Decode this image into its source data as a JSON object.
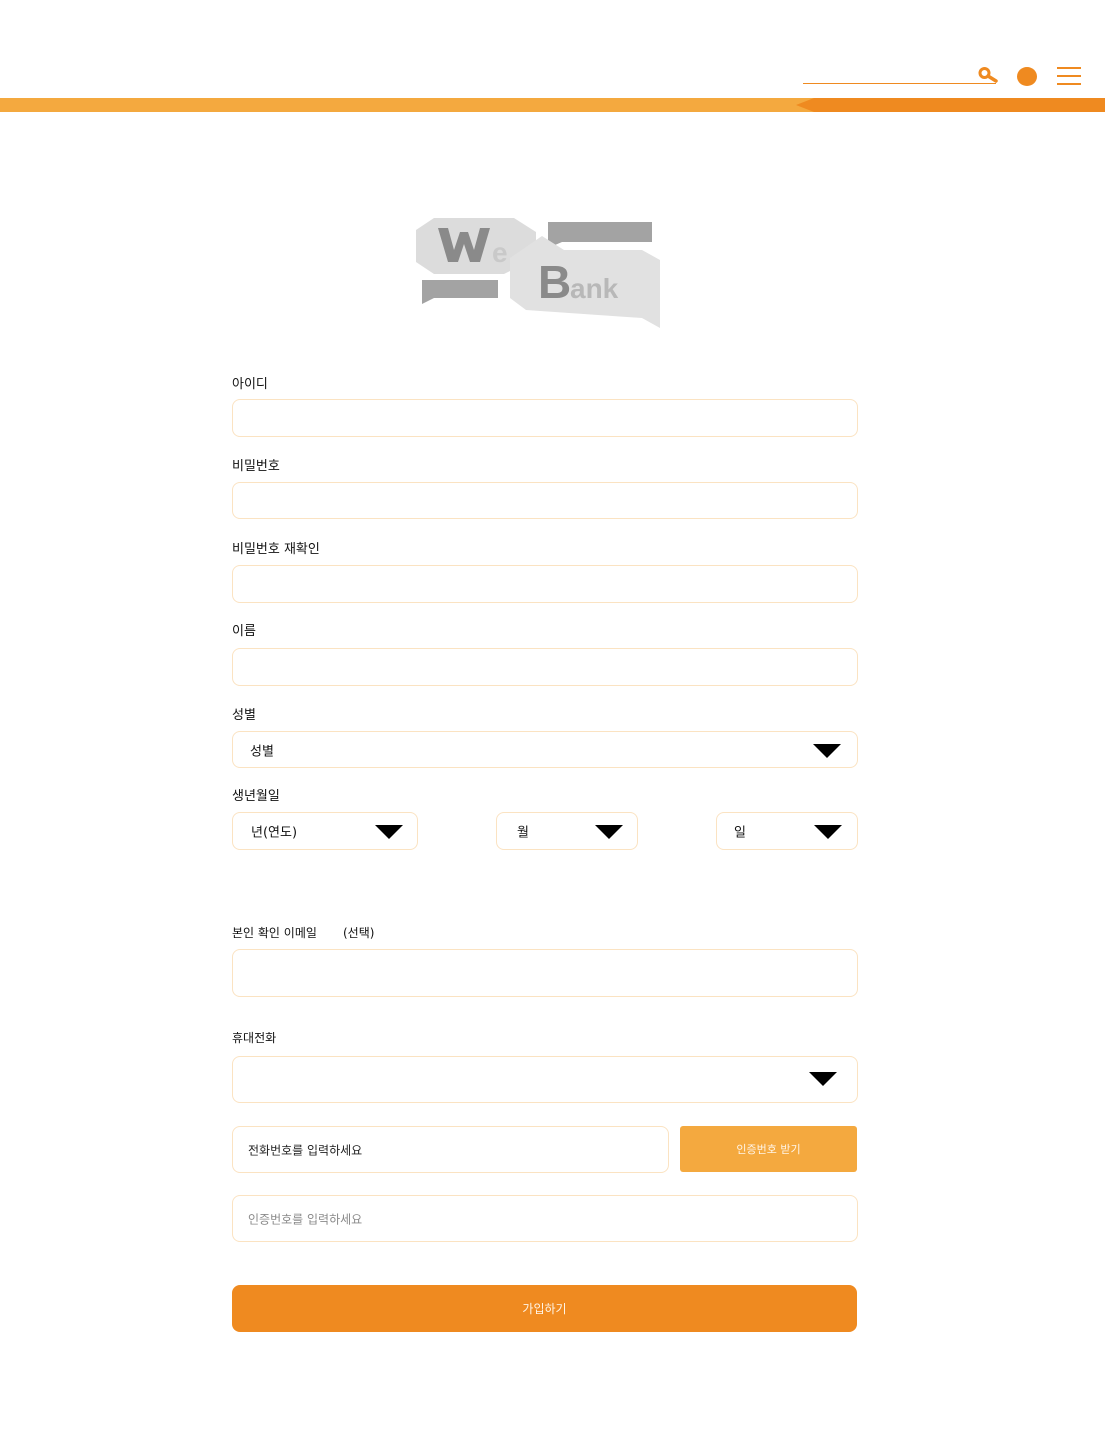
{
  "brand": {
    "accent": "#ef8a20",
    "accent_light": "#f4a93f",
    "field_border": "#fbe3c2",
    "logo_text": "WeBank"
  },
  "header": {
    "search": {
      "placeholder": ""
    },
    "icons": [
      "search-icon",
      "profile-dot",
      "menu-icon"
    ]
  },
  "form": {
    "id_label": "아이디",
    "password_label": "비밀번호",
    "password_confirm_label": "비밀번호 재확인",
    "name_label": "이름",
    "gender_label": "성별",
    "gender_select": "성별",
    "birth_label": "생년월일",
    "birth_year": "년(연도)",
    "birth_month": "월",
    "birth_day": "일",
    "email_label": "본인 확인 이메일",
    "email_optional": "(선택)",
    "phone_label": "휴대전화",
    "phone_carrier_select": "",
    "phone_number_placeholder": "전화번호를 입력하세요",
    "verify_button": "인증번호 받기",
    "verify_code_placeholder": "인증번호를 입력하세요",
    "submit_button": "가입하기"
  }
}
